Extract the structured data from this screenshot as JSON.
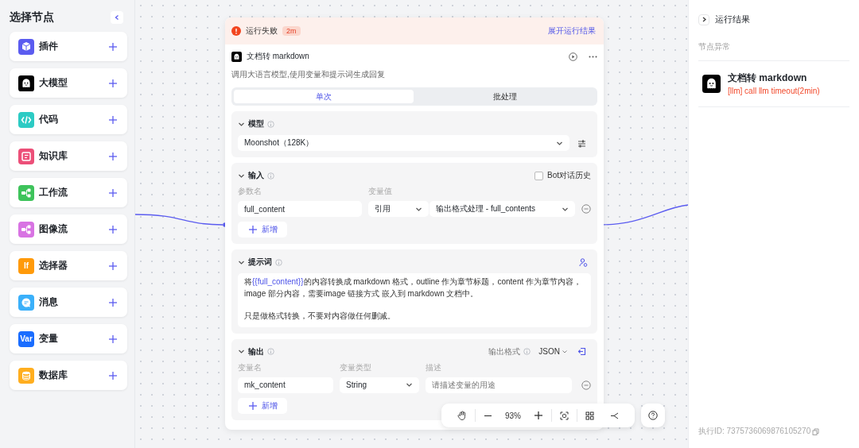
{
  "sidebar": {
    "title": "选择节点",
    "items": [
      {
        "label": "插件",
        "kind": "cube",
        "color": "#5b5cf0"
      },
      {
        "label": "大模型",
        "kind": "ghost",
        "color": "#000000"
      },
      {
        "label": "代码",
        "kind": "code",
        "color": "#2ccbc4"
      },
      {
        "label": "知识库",
        "kind": "book",
        "color": "#ec4f78"
      },
      {
        "label": "工作流",
        "kind": "flow",
        "color": "#3ec35b"
      },
      {
        "label": "图像流",
        "kind": "flow",
        "color": "#d873e3"
      },
      {
        "label": "选择器",
        "kind": "text",
        "icon_text": "If",
        "color": "#ff9a0a"
      },
      {
        "label": "消息",
        "kind": "chat",
        "color": "#3ab0fa"
      },
      {
        "label": "变量",
        "kind": "text",
        "icon_text": "Var",
        "color": "#1a6dff"
      },
      {
        "label": "数据库",
        "kind": "database",
        "color": "#ffae1f"
      }
    ]
  },
  "node": {
    "status": {
      "text": "运行失败",
      "duration": "2m",
      "link": "展开运行结果"
    },
    "title": "文档转 markdown",
    "description": "调用大语言模型,使用变量和提示词生成回复",
    "tabs": [
      {
        "label": "单次",
        "selected": true
      },
      {
        "label": "批处理",
        "selected": false
      }
    ],
    "model": {
      "title": "模型",
      "value": "Moonshot（128K）"
    },
    "input": {
      "title": "输入",
      "history": {
        "label": "Bot对话历史",
        "checked": false
      },
      "columns": [
        "参数名",
        "变量值"
      ],
      "rows": [
        {
          "name": "full_content",
          "source": "引用",
          "value": "输出格式处理 - full_contents"
        }
      ],
      "add": "新增"
    },
    "prompt": {
      "title": "提示词",
      "paragraphs": [
        [
          {
            "kind": "text",
            "text": "将"
          },
          {
            "kind": "variable",
            "text": "{{full_content}}"
          },
          {
            "kind": "text",
            "text": "的内容转换成 markdown 格式，outline 作为章节标题，content 作为章节内容，image 部分内容，需要image 链接方式 嵌入到 markdown 文档中。"
          }
        ],
        [
          {
            "kind": "text",
            "text": "只是做格式转换，不要对内容做任何删减。"
          }
        ]
      ]
    },
    "output": {
      "title": "输出",
      "format_label": "输出格式",
      "format": "JSON",
      "columns": [
        "变量名",
        "变量类型",
        "描述"
      ],
      "rows": [
        {
          "name": "mk_content",
          "type": "String",
          "placeholder": "请描述变量的用途"
        }
      ],
      "add": "新增"
    }
  },
  "toolbar": {
    "zoom": "93%"
  },
  "result": {
    "title": "运行结果",
    "section": "节点异常",
    "items": [
      {
        "title": "文档转 markdown",
        "error": "[llm] call llm timeout(2min)"
      }
    ],
    "execution_id": "执行ID: 7375736069876105270"
  }
}
